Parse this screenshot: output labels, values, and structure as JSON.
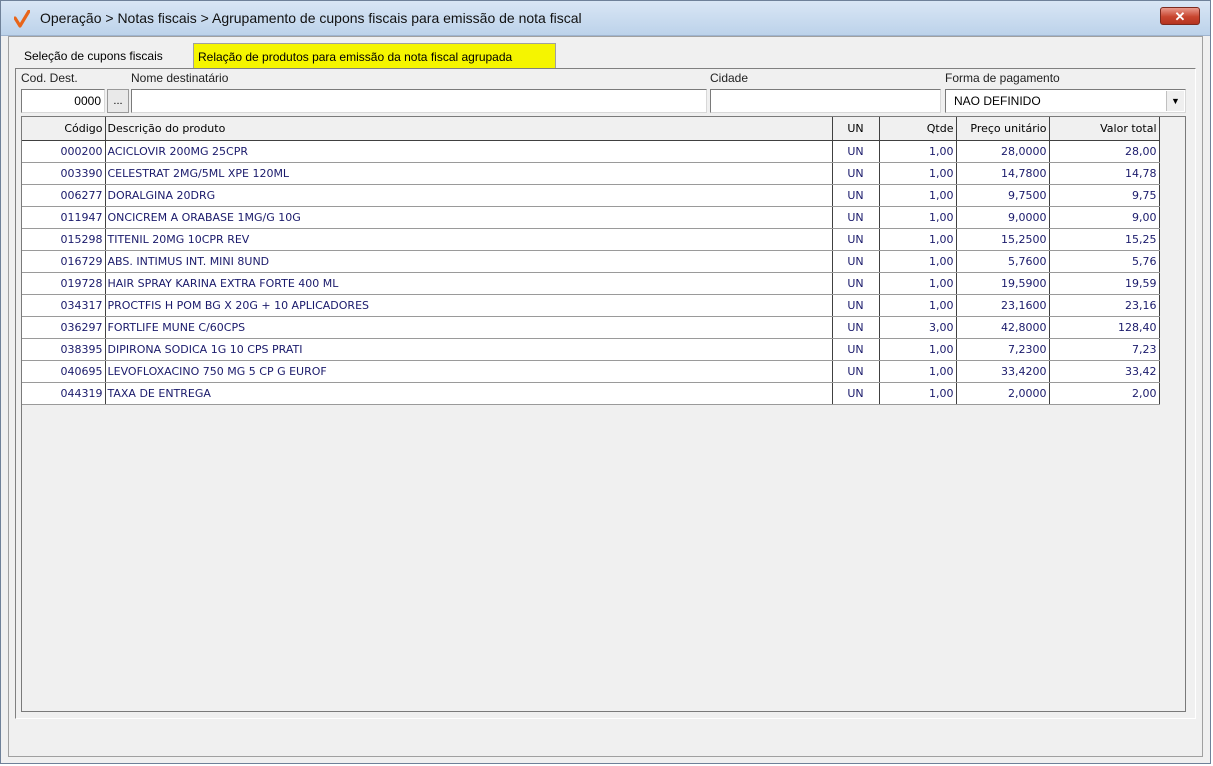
{
  "window": {
    "title": "Operação > Notas fiscais > Agrupamento de cupons fiscais para emissão de nota fiscal",
    "close_label": "✕",
    "accent_color": "#e8651a"
  },
  "tabs": [
    {
      "label": "Seleção de cupons fiscais",
      "active": false
    },
    {
      "label": "Relação de produtos para emissão da nota fiscal agrupada",
      "active": true,
      "color": "#f5f500"
    }
  ],
  "form": {
    "cod_dest_label": "Cod. Dest.",
    "cod_dest_value": "0000",
    "lookup_label": "...",
    "nome_label": "Nome destinatário",
    "nome_value": "",
    "cidade_label": "Cidade",
    "cidade_value": "",
    "pagamento_label": "Forma de pagamento",
    "pagamento_value": "NAO DEFINIDO"
  },
  "grid": {
    "columns": [
      "Código",
      "Descrição do produto",
      "UN",
      "Qtde",
      "Preço unitário",
      "Valor total"
    ],
    "rows": [
      [
        "000200",
        "ACICLOVIR 200MG 25CPR",
        "UN",
        "1,00",
        "28,0000",
        "28,00"
      ],
      [
        "003390",
        "CELESTRAT 2MG/5ML XPE 120ML",
        "UN",
        "1,00",
        "14,7800",
        "14,78"
      ],
      [
        "006277",
        "DORALGINA 20DRG",
        "UN",
        "1,00",
        "9,7500",
        "9,75"
      ],
      [
        "011947",
        "ONCICREM A ORABASE 1MG/G 10G",
        "UN",
        "1,00",
        "9,0000",
        "9,00"
      ],
      [
        "015298",
        "TITENIL 20MG 10CPR REV",
        "UN",
        "1,00",
        "15,2500",
        "15,25"
      ],
      [
        "016729",
        "ABS. INTIMUS INT. MINI 8UND",
        "UN",
        "1,00",
        "5,7600",
        "5,76"
      ],
      [
        "019728",
        "HAIR SPRAY KARINA EXTRA FORTE 400 ML",
        "UN",
        "1,00",
        "19,5900",
        "19,59"
      ],
      [
        "034317",
        "PROCTFIS H POM BG X 20G + 10 APLICADORES",
        "UN",
        "1,00",
        "23,1600",
        "23,16"
      ],
      [
        "036297",
        "FORTLIFE MUNE C/60CPS",
        "UN",
        "3,00",
        "42,8000",
        "128,40"
      ],
      [
        "038395",
        "DIPIRONA SODICA 1G 10 CPS PRATI",
        "UN",
        "1,00",
        "7,2300",
        "7,23"
      ],
      [
        "040695",
        "LEVOFLOXACINO 750 MG 5 CP G EUROF",
        "UN",
        "1,00",
        "33,4200",
        "33,42"
      ],
      [
        "044319",
        "TAXA DE ENTREGA",
        "UN",
        "1,00",
        "2,0000",
        "2,00"
      ]
    ]
  }
}
